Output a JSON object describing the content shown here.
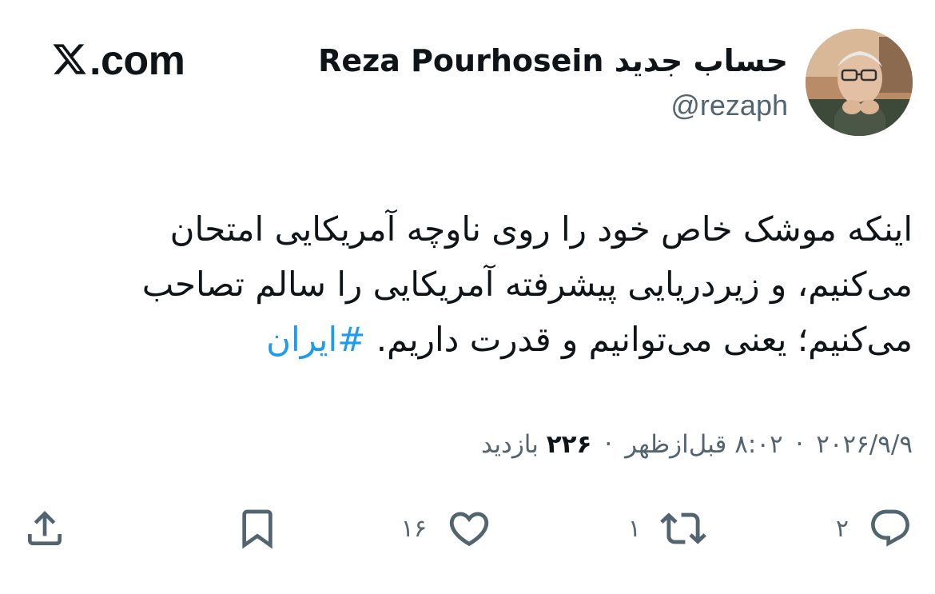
{
  "header": {
    "brand": ".com",
    "display_name": "حساب جدید Reza Pourhosein",
    "display_name_fa": "حساب جدید",
    "display_name_en": "Reza Pourhosein",
    "handle": "@rezaph"
  },
  "tweet": {
    "text": "اینکه موشک خاص خود را روی ناوچه آمریکایی امتحان می‌کنیم، و زیردریایی پیشرفته آمریکایی را سالم تصاحب می‌کنیم؛ یعنی می‌توانیم و قدرت داریم.",
    "hashtag": "#ایران"
  },
  "meta": {
    "date": "۲۰۲۶/۹/۹",
    "time": "۸:۰۲ قبل‌ازظهر",
    "separator": "·",
    "views_count": "۲۲۶",
    "views_label": "بازدید"
  },
  "actions": {
    "reply_count": "۲",
    "retweet_count": "۱",
    "like_count": "۱۶",
    "icons": {
      "reply": "reply-icon",
      "retweet": "retweet-icon",
      "like": "heart-icon",
      "bookmark": "bookmark-icon",
      "share": "share-icon"
    }
  },
  "colors": {
    "text": "#0f1419",
    "secondary": "#536471",
    "hashtag": "#1d9bf0",
    "background": "#ffffff"
  }
}
